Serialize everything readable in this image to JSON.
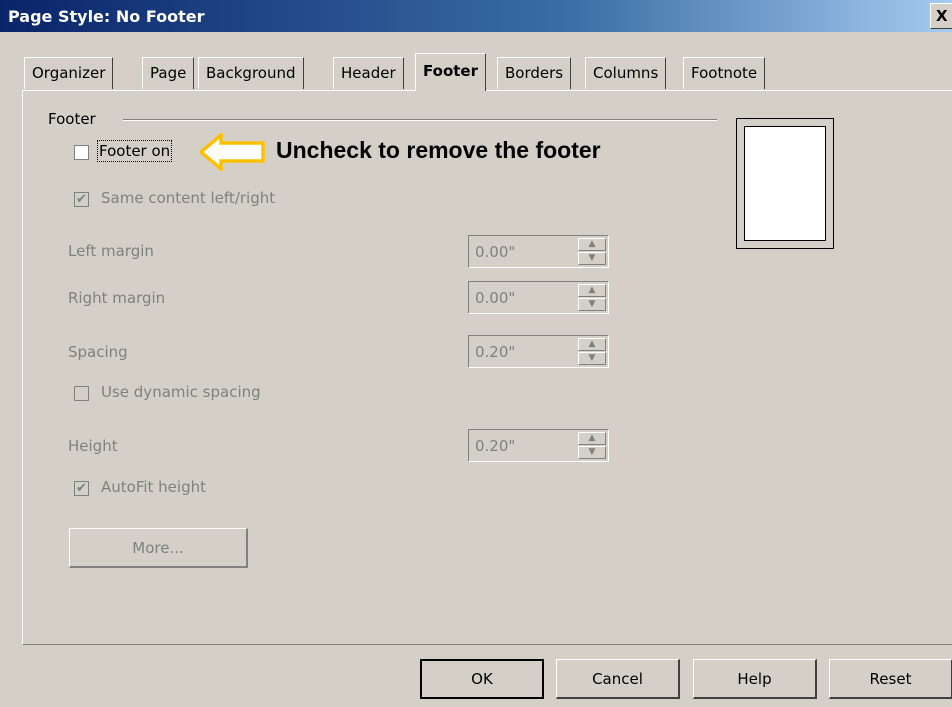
{
  "window": {
    "title": "Page Style: No Footer",
    "close_glyph": "X"
  },
  "tabs": [
    {
      "label": "Organizer"
    },
    {
      "label": "Page"
    },
    {
      "label": "Background"
    },
    {
      "label": "Header"
    },
    {
      "label": "Footer",
      "active": true
    },
    {
      "label": "Borders"
    },
    {
      "label": "Columns"
    },
    {
      "label": "Footnote"
    }
  ],
  "footer_group": {
    "label": "Footer",
    "footer_on": {
      "label": "Footer on",
      "checked": false
    },
    "same_content": {
      "label": "Same content left/right",
      "checked": true,
      "enabled": false
    },
    "left_margin": {
      "label": "Left margin",
      "value": "0.00\""
    },
    "right_margin": {
      "label": "Right margin",
      "value": "0.00\""
    },
    "spacing": {
      "label": "Spacing",
      "value": "0.20\""
    },
    "dynamic_spacing": {
      "label": "Use dynamic spacing",
      "checked": false,
      "enabled": false
    },
    "height": {
      "label": "Height",
      "value": "0.20\""
    },
    "autofit": {
      "label": "AutoFit height",
      "checked": true,
      "enabled": false
    },
    "more_button": "More..."
  },
  "annotation": {
    "text": "Uncheck to remove the footer",
    "arrow_color": "#ffc000"
  },
  "buttons": {
    "ok": "OK",
    "cancel": "Cancel",
    "help": "Help",
    "reset": "Reset"
  },
  "spin_glyphs": {
    "up": "▲",
    "down": "▼"
  },
  "check_glyph": "✔"
}
